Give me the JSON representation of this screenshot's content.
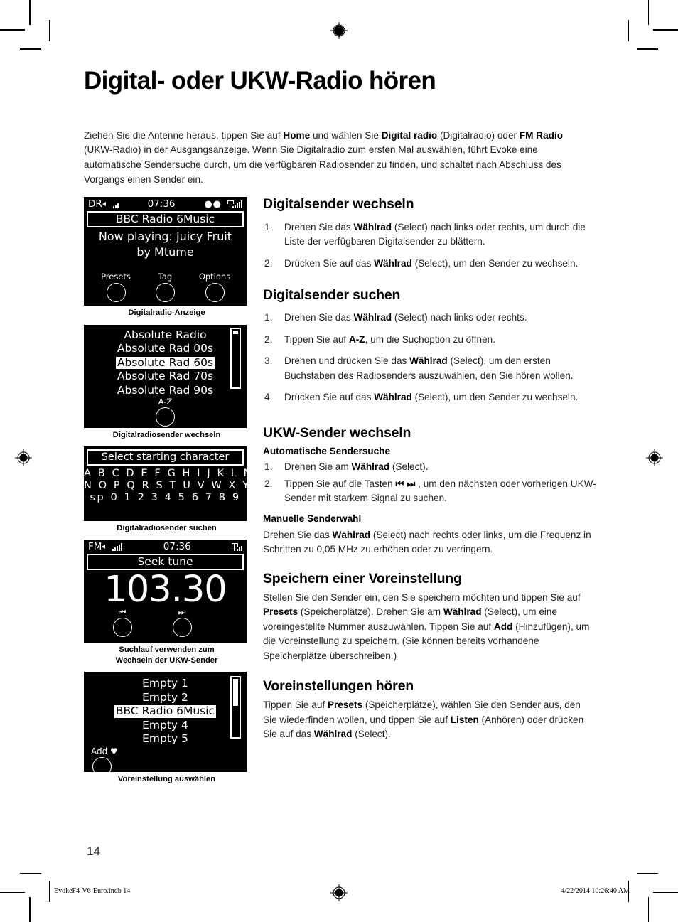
{
  "page": {
    "title": "Digital- oder UKW-Radio hören",
    "folio": "14",
    "footer_left": "EvokeF4-V6-Euro.indb   14",
    "footer_right": "4/22/2014   10:26:40 AM"
  },
  "intro": {
    "t1": "Ziehen Sie die Antenne heraus, tippen Sie auf ",
    "b1": "Home",
    "t2": " und wählen Sie ",
    "b2": "Digital radio",
    "t3": " (Digitalradio) oder ",
    "b3": "FM Radio",
    "t4": " (UKW-Radio) in der Ausgangsanzeige. Wenn Sie Digitalradio zum ersten Mal auswählen, führt Evoke eine automatische Sendersuche durch, um die verfügbaren Radiosender zu finden, und schaltet nach Abschluss des Vorgangs einen Sender ein."
  },
  "screens": {
    "now_playing": {
      "mode": "DR",
      "time": "07:36",
      "station": "BBC Radio 6Music",
      "line1": "Now playing: Juicy Fruit",
      "line2": "by Mtume",
      "softkeys": [
        "Presets",
        "Tag",
        "Options"
      ],
      "caption": "Digitalradio-Anzeige"
    },
    "station_list": {
      "items": [
        "Absolute Radio",
        "Absolute Rad 00s",
        "Absolute Rad 60s",
        "Absolute Rad 70s",
        "Absolute Rad 90s"
      ],
      "selected_index": 2,
      "softkey": "A-Z",
      "caption": "Digitalradiosender wechseln"
    },
    "char_select": {
      "title": "Select starting character",
      "rows": [
        "A B C D E F G H I J K L M",
        "N O P Q R S T U V W X Y Z",
        "sp 0 1 2 3 4 5 6 7 8 9"
      ],
      "caption": "Digitalradiosender suchen"
    },
    "fm": {
      "mode": "FM",
      "time": "07:36",
      "title": "Seek tune",
      "frequency": "103.30",
      "softkeys": [
        "skip-back-icon",
        "skip-forward-icon"
      ],
      "caption_line1": "Suchlauf verwenden zum",
      "caption_line2": "Wechseln der UKW-Sender"
    },
    "presets": {
      "items": [
        "Empty 1",
        "Empty 2",
        "BBC Radio 6Music",
        "Empty 4",
        "Empty 5"
      ],
      "selected_index": 2,
      "softkey": "Add ♥",
      "caption": "Voreinstellung auswählen"
    }
  },
  "sections": {
    "digitalsender_wechseln": {
      "heading": "Digitalsender wechseln",
      "steps": [
        {
          "a": "Drehen Sie das ",
          "b": "Wählrad",
          "c": " (Select) nach links oder rechts, um durch die Liste der verfügbaren Digitalsender zu blättern."
        },
        {
          "a": "Drücken Sie auf das ",
          "b": "Wählrad",
          "c": " (Select), um den Sender zu wechseln."
        }
      ]
    },
    "digitalsender_suchen": {
      "heading": "Digitalsender suchen",
      "steps": [
        {
          "a": "Drehen Sie das ",
          "b": "Wählrad",
          "c": " (Select) nach links oder rechts."
        },
        {
          "a": "Tippen Sie auf ",
          "b": "A-Z",
          "c": ", um die Suchoption zu öffnen."
        },
        {
          "a": "Drehen und drücken Sie das ",
          "b": "Wählrad",
          "c": " (Select), um den ersten Buchstaben des Radiosenders auszuwählen, den Sie hören wollen."
        },
        {
          "a": "Drücken Sie auf das ",
          "b": "Wählrad",
          "c": " (Select), um den Sender zu wechseln."
        }
      ]
    },
    "ukw_sender_wechseln": {
      "heading": "UKW-Sender wechseln",
      "sub_auto": "Automatische Sendersuche",
      "auto_steps": [
        {
          "a": "Drehen Sie am ",
          "b": "Wählrad",
          "c": " (Select)."
        },
        {
          "a": "Tippen Sie auf die Tasten ",
          "icon": "⏮ ⏭",
          "c": " , um den nächsten oder vorherigen UKW-Sender mit starkem Signal zu suchen."
        }
      ],
      "sub_manual": "Manuelle Senderwahl",
      "manual_a": "Drehen Sie das ",
      "manual_b": "Wählrad",
      "manual_c": " (Select) nach rechts oder links, um die Frequenz in Schritten zu 0,05 MHz zu erhöhen oder zu verringern."
    },
    "speichern": {
      "heading": "Speichern einer Voreinstellung",
      "p_a": "Stellen Sie den Sender ein, den Sie speichern möchten und tippen Sie auf ",
      "p_b1": "Presets",
      "p_c": " (Speicherplätze). Drehen Sie am ",
      "p_b2": "Wählrad",
      "p_d": " (Select), um eine voreingestellte Nummer auszuwählen. Tippen Sie auf ",
      "p_b3": "Add",
      "p_e": " (Hinzufügen), um die Voreinstellung zu speichern. (Sie können bereits vorhandene Speicherplätze überschreiben.)"
    },
    "voreinstellungen_hoeren": {
      "heading": "Voreinstellungen hören",
      "p_a": "Tippen Sie auf ",
      "p_b1": "Presets",
      "p_c": " (Speicherplätze), wählen Sie den Sender aus, den Sie wiederfinden wollen, und tippen Sie auf ",
      "p_b2": "Listen",
      "p_d": " (Anhören) oder drücken Sie auf das ",
      "p_b3": "Wählrad",
      "p_e": " (Select)."
    }
  }
}
